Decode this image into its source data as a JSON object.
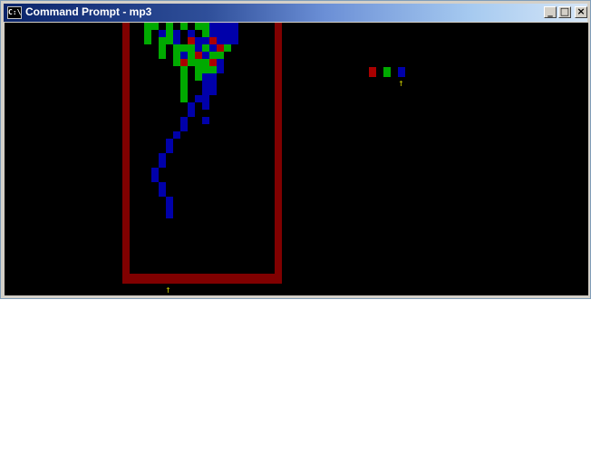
{
  "window": {
    "title": "Command Prompt - mp3",
    "icon": "console-icon"
  },
  "titlebar_buttons": {
    "minimize": "_",
    "maximize": "□",
    "close": "×"
  },
  "colors": {
    "wall": "#800000",
    "red": "#aa0000",
    "green": "#00aa00",
    "blue": "#0000aa",
    "arrow": "#c0c000"
  },
  "preview_colors": [
    "red",
    "green",
    "blue"
  ],
  "arrows": {
    "glyph": "↑"
  }
}
